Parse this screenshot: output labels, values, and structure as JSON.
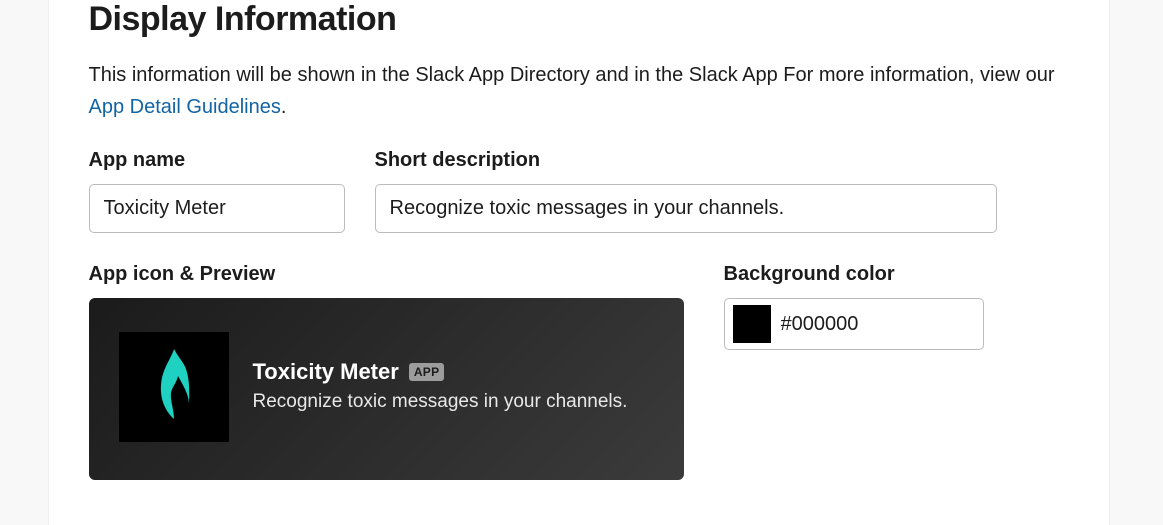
{
  "section": {
    "title": "Display Information",
    "description_prefix": "This information will be shown in the Slack App Directory and in the Slack App For more information, view our ",
    "guidelines_link_text": "App Detail Guidelines",
    "description_suffix": "."
  },
  "fields": {
    "app_name": {
      "label": "App name",
      "value": "Toxicity Meter"
    },
    "short_description": {
      "label": "Short description",
      "value": "Recognize toxic messages in your channels."
    },
    "app_icon_preview": {
      "label": "App icon & Preview"
    },
    "background_color": {
      "label": "Background color",
      "value": "#000000",
      "swatch_hex": "#000000"
    }
  },
  "preview": {
    "app_name": "Toxicity Meter",
    "badge": "APP",
    "description": "Recognize toxic messages in your channels.",
    "icon_name": "flame-icon",
    "icon_color": "#1fd1c0",
    "background_gradient_from": "#1b1b1b",
    "background_gradient_to": "#3b3b3b"
  }
}
